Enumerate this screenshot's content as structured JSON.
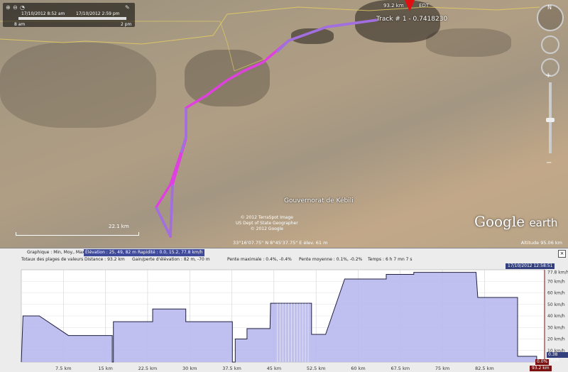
{
  "time_slider": {
    "start_label": "17/10/2012    8:52 am",
    "end_label": "17/10/2012    2:59 pm",
    "left_tick": "8 am",
    "right_tick": "2 pm"
  },
  "map": {
    "track_label": "Track # 1 - 0.7418230",
    "marker_distance": "93.2 km",
    "marker_elevation": "EDT",
    "region_label": "Gouvernorat de Kébili",
    "scale_label": "22.1 km",
    "credits": [
      "© 2012 TerraSpot Image",
      "US Dept of State Geographer",
      "© 2012 Google"
    ],
    "coordinates": "33°16'07.75\" N   8°45'37.75\" E élev.   61 m",
    "eye_altitude": "Altitude   95.06 km",
    "logo_main": "Google",
    "logo_sub": "earth",
    "compass_n": "N",
    "zoom_plus": "+",
    "zoom_minus": "−",
    "colors": {
      "track_magenta": "#e040e0",
      "track_purple": "#a070e0",
      "boundary": "#e8d060"
    }
  },
  "profile_panel": {
    "row1": {
      "graph_label": "Graphique : Min, Moy., Max",
      "elevation": "Élévation : 25, 49, 82 m",
      "speed": "Rapidité : 0.0, 15.2, 77.8 km/h"
    },
    "row2": {
      "range_totals": "Totaux des plages de valeurs",
      "distance": "Distance : 93.2 km",
      "gain_loss": "Gain/perte d'élévation :   82 m, -70 m",
      "max_slope": "Pente maximale :   0.4%, -0.4%",
      "avg_slope": "Pente moyenne :   0.1%, -0.2%",
      "time": "Temps :   6 h 7 mn 7 s"
    },
    "close": "×",
    "timestamp": "17/10/2012 12:58:51",
    "current_distance": "93.2 km",
    "current_pct": "0.0%",
    "current_speed": "0.38 km/h"
  },
  "chart_data": {
    "type": "area",
    "xlabel": "",
    "ylabel": "",
    "x_unit": "km",
    "y_unit": "km/h",
    "x_ticks": [
      "7.5 km",
      "15 km",
      "22.5 km",
      "30 km",
      "37.5 km",
      "45 km",
      "52.5 km",
      "60 km",
      "67.5 km",
      "75 km",
      "82.5 km",
      "93.2 km"
    ],
    "y_ticks": [
      "77.8 km/h",
      "70 km/h",
      "60 km/h",
      "50 km/h",
      "40 km/h",
      "30 km/h",
      "20 km/h",
      "10 km/h"
    ],
    "xlim": [
      0,
      93.2
    ],
    "ylim": [
      0,
      80
    ],
    "series": [
      {
        "name": "",
        "x": [
          0,
          0.3,
          3.2,
          3.2,
          8.4,
          8.4,
          16.2,
          16.2,
          16.4,
          16.4,
          23.4,
          23.4,
          29.3,
          29.3,
          37.6,
          37.6,
          38.1,
          38.1,
          40.2,
          40.2,
          44.3,
          44.3,
          44.4,
          44.4,
          51.7,
          51.7,
          54.2,
          54.2,
          57.6,
          57.6,
          65.0,
          65.0,
          69.8,
          69.8,
          69.9,
          69.9,
          81.0,
          81.0,
          81.3,
          81.3,
          83.6,
          83.6,
          88.4,
          88.4,
          91.8,
          91.8,
          93.2
        ],
        "values": [
          0,
          40,
          40,
          40,
          23,
          23,
          23,
          0,
          0,
          35,
          35,
          46,
          46,
          35,
          35,
          0,
          0,
          20,
          20,
          29,
          29,
          29,
          51,
          51,
          51,
          24,
          24,
          24,
          72,
          72,
          72,
          76,
          76,
          76,
          76,
          77.8,
          77.8,
          77.8,
          56,
          56,
          56,
          56,
          56,
          5,
          5,
          0.4,
          0.4
        ]
      }
    ]
  }
}
